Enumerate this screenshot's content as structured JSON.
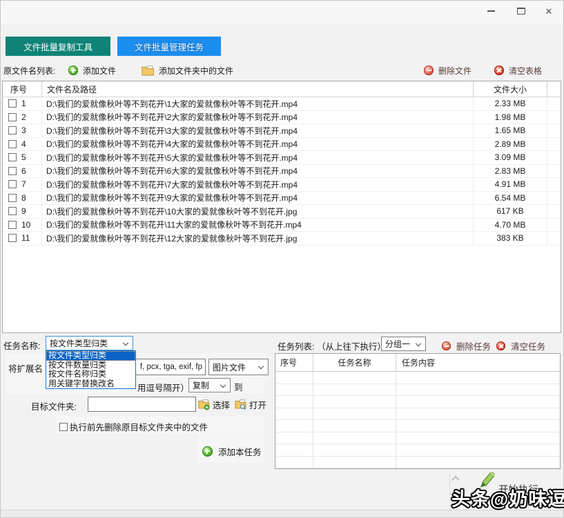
{
  "colors": {
    "tab_copy_bg": "#0F8377",
    "tab_manage_bg": "#1B8DEE",
    "list_selection_bg": "#0B63C5",
    "danger_text": "#5A3C38"
  },
  "titlebar": {
    "close_glyph": "✕"
  },
  "tabs": {
    "copy_tool": "文件批量复制工具",
    "manage_tasks": "文件批量管理任务"
  },
  "toolbar": {
    "source_list_label": "原文件名列表:",
    "add_file": "添加文件",
    "add_folder_files": "添加文件夹中的文件",
    "delete_file": "删除文件",
    "clear_table": "清空表格"
  },
  "file_table": {
    "headers": {
      "index": "序号",
      "path": "文件名及路径",
      "size": "文件大小"
    },
    "rows": [
      {
        "index": "1",
        "path": "D:\\我们的爱就像秋叶等不到花开\\1大家的爱就像秋叶等不到花开.mp4",
        "size": "2.33 MB"
      },
      {
        "index": "2",
        "path": "D:\\我们的爱就像秋叶等不到花开\\2大家的爱就像秋叶等不到花开.mp4",
        "size": "1.98 MB"
      },
      {
        "index": "3",
        "path": "D:\\我们的爱就像秋叶等不到花开\\3大家的爱就像秋叶等不到花开.mp4",
        "size": "1.65 MB"
      },
      {
        "index": "4",
        "path": "D:\\我们的爱就像秋叶等不到花开\\4大家的爱就像秋叶等不到花开.mp4",
        "size": "2.89 MB"
      },
      {
        "index": "5",
        "path": "D:\\我们的爱就像秋叶等不到花开\\5大家的爱就像秋叶等不到花开.mp4",
        "size": "3.09 MB"
      },
      {
        "index": "6",
        "path": "D:\\我们的爱就像秋叶等不到花开\\6大家的爱就像秋叶等不到花开.mp4",
        "size": "2.83 MB"
      },
      {
        "index": "7",
        "path": "D:\\我们的爱就像秋叶等不到花开\\7大家的爱就像秋叶等不到花开.mp4",
        "size": "4.91 MB"
      },
      {
        "index": "8",
        "path": "D:\\我们的爱就像秋叶等不到花开\\9大家的爱就像秋叶等不到花开.mp4",
        "size": "6.54 MB"
      },
      {
        "index": "9",
        "path": "D:\\我们的爱就像秋叶等不到花开\\10大家的爱就像秋叶等不到花开.jpg",
        "size": "617 KB"
      },
      {
        "index": "10",
        "path": "D:\\我们的爱就像秋叶等不到花开\\11大家的爱就像秋叶等不到花开.mp4",
        "size": "4.70 MB"
      },
      {
        "index": "11",
        "path": "D:\\我们的爱就像秋叶等不到花开\\12大家的爱就像秋叶等不到花开.jpg",
        "size": "383 KB"
      }
    ]
  },
  "task_form": {
    "task_name_label": "任务名称:",
    "task_type_value": "按文件类型归类",
    "task_type_options": [
      "按文件类型归类",
      "按文件数量归类",
      "按文件名称归类",
      "用关键字替换改名"
    ],
    "extension_label": "将扩展名",
    "extension_value": "f, pcx, tga, exif, fp",
    "file_type_value": "图片文件",
    "comma_hint": "用逗号隔开）",
    "action_value": "复制",
    "to_label": "到",
    "target_folder_label": "目标文件夹:",
    "target_folder_value": "",
    "select_button": "选择",
    "open_button": "打开",
    "pre_delete_checkbox_label": "执行前先删除原目标文件夹中的文件",
    "add_task_button": "添加本任务"
  },
  "task_panel": {
    "title": "任务列表: （从上往下执行）",
    "group_value": "分组一",
    "delete_task_button": "删除任务",
    "clear_tasks_button": "清空任务",
    "headers": {
      "index": "序号",
      "name": "任务名称",
      "content": "任务内容"
    }
  },
  "footer": {
    "start_button": "开始执行",
    "watermark": "头条@奶味逗"
  },
  "icons": {
    "add": "green-plus-circle",
    "add_folder": "yellow-folder-page",
    "delete": "red-minus-circle",
    "clear": "red-x-circle",
    "select_folder": "folder-plus",
    "open_folder": "folder-search",
    "start": "green-pencil",
    "combo": "chevron-down",
    "scroll": "chevron-up-down"
  }
}
